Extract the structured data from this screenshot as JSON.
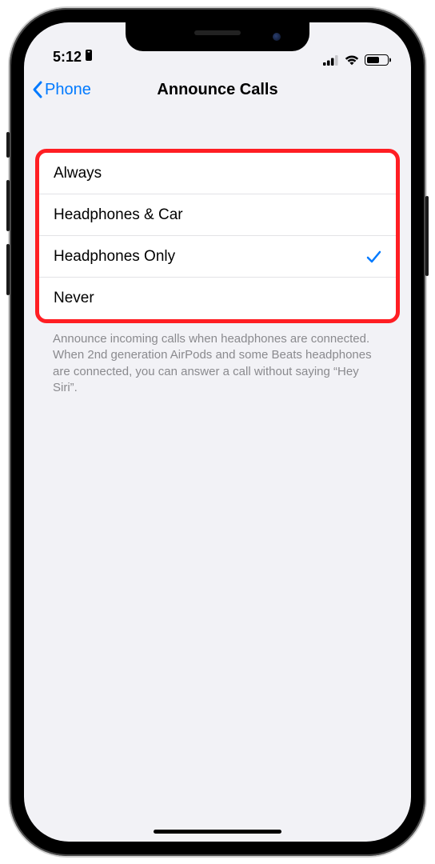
{
  "status": {
    "time": "5:12"
  },
  "nav": {
    "back_label": "Phone",
    "title": "Announce Calls"
  },
  "options": [
    {
      "label": "Always",
      "selected": false
    },
    {
      "label": "Headphones & Car",
      "selected": false
    },
    {
      "label": "Headphones Only",
      "selected": true
    },
    {
      "label": "Never",
      "selected": false
    }
  ],
  "footer": "Announce incoming calls when headphones are connected. When 2nd generation AirPods and some Beats headphones are connected, you can answer a call without saying “Hey Siri”."
}
